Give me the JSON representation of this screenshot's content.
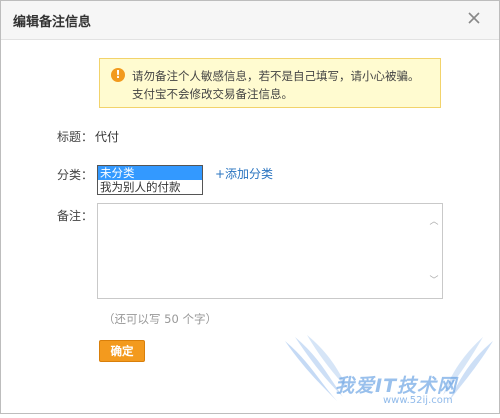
{
  "dialog": {
    "title": "编辑备注信息",
    "close_icon": "close-icon"
  },
  "warning": {
    "icon": "exclamation-icon",
    "line1": "请勿备注个人敏感信息，若不是自己填写，请小心被骗。",
    "line2": "支付宝不会修改交易备注信息。"
  },
  "fields": {
    "title_label": "标题：",
    "title_value": "代付",
    "category_label": "分类：",
    "category_options": [
      "未分类",
      "我为别人的付款"
    ],
    "category_selected": "未分类",
    "add_category": "+添加分类",
    "note_label": "备注：",
    "note_value": "",
    "note_hint": "（还可以写 50 个字）"
  },
  "actions": {
    "confirm": "确定"
  },
  "watermark": {
    "text": "我爱IT技术网",
    "url": "www.52ij.com"
  },
  "colors": {
    "accent_orange": "#f39a1e",
    "link_blue": "#2a74c0",
    "warning_bg": "#fffbd0",
    "selected_option": "#3399ff"
  }
}
